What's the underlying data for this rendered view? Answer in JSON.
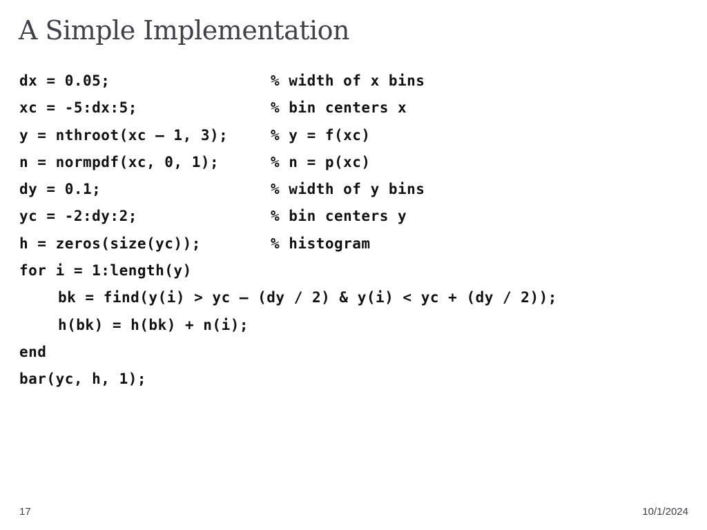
{
  "slide": {
    "title": "A Simple Implementation",
    "code_lines": [
      {
        "code": "dx = 0.05;",
        "comment": "% width of x bins"
      },
      {
        "code": "xc = -5:dx:5;",
        "comment": "% bin centers x"
      },
      {
        "code": "y = nthroot(xc – 1, 3);",
        "comment": "% y = f(xc)"
      },
      {
        "code": "n = normpdf(xc, 0, 1);",
        "comment": "% n = p(xc)"
      },
      {
        "code": "dy = 0.1;",
        "comment": "% width of y bins"
      },
      {
        "code": "yc = -2:dy:2;",
        "comment": "% bin centers y"
      },
      {
        "code": "h = zeros(size(yc));",
        "comment": "% histogram"
      },
      {
        "code": "for i = 1:length(y)",
        "comment": ""
      },
      {
        "code": "bk = find(y(i) > yc – (dy / 2) & y(i) < yc + (dy / 2));",
        "comment": ""
      },
      {
        "code": "h(bk) = h(bk) + n(i);",
        "comment": ""
      },
      {
        "code": "end",
        "comment": ""
      },
      {
        "code": "bar(yc, h, 1);",
        "comment": ""
      }
    ],
    "footer": {
      "page_number": "17",
      "date": "10/1/2024"
    }
  }
}
